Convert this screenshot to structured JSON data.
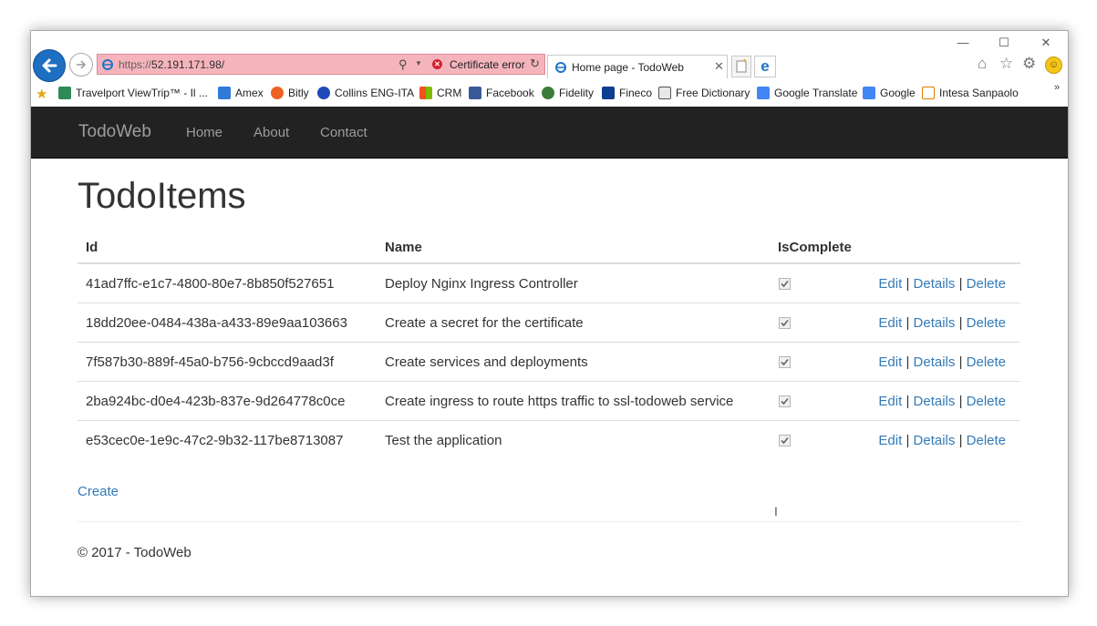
{
  "browser": {
    "window_controls": {
      "minimize": "—",
      "maximize": "☐",
      "close": "✕"
    },
    "address": {
      "scheme": "https://",
      "host": "52.191.171.98/"
    },
    "cert_error": "Certificate error",
    "tab_title": "Home page - TodoWeb",
    "tab_close": "✕",
    "favorites": [
      {
        "label": "Travelport ViewTrip™ - Il ...",
        "icon": "travelport-icon",
        "color": "#2e8b57"
      },
      {
        "label": "Amex",
        "icon": "amex-icon",
        "color": "#2f7bd6"
      },
      {
        "label": "Bitly",
        "icon": "bitly-icon",
        "color": "#ee6123"
      },
      {
        "label": "Collins ENG-ITA",
        "icon": "collins-icon",
        "color": "#1f49b5"
      },
      {
        "label": "CRM",
        "icon": "crm-icon",
        "color": "#f25022"
      },
      {
        "label": "Facebook",
        "icon": "facebook-icon",
        "color": "#3b5998"
      },
      {
        "label": "Fidelity",
        "icon": "fidelity-icon",
        "color": "#3a7d3a"
      },
      {
        "label": "Fineco",
        "icon": "fineco-icon",
        "color": "#0b3d91"
      },
      {
        "label": "Free Dictionary",
        "icon": "dictionary-icon",
        "color": "#555555"
      },
      {
        "label": "Google Translate",
        "icon": "translate-icon",
        "color": "#4285f4"
      },
      {
        "label": "Google",
        "icon": "google-icon",
        "color": "#4285f4"
      },
      {
        "label": "Intesa Sanpaolo",
        "icon": "intesa-icon",
        "color": "#e07b00"
      }
    ],
    "favorites_more": "»"
  },
  "nav": {
    "brand": "TodoWeb",
    "links": [
      "Home",
      "About",
      "Contact"
    ]
  },
  "page": {
    "title": "TodoItems",
    "columns": {
      "id": "Id",
      "name": "Name",
      "complete": "IsComplete"
    },
    "rows": [
      {
        "id": "41ad7ffc-e1c7-4800-80e7-8b850f527651",
        "name": "Deploy Nginx Ingress Controller",
        "complete": true
      },
      {
        "id": "18dd20ee-0484-438a-a433-89e9aa103663",
        "name": "Create a secret for the certificate",
        "complete": true
      },
      {
        "id": "7f587b30-889f-45a0-b756-9cbccd9aad3f",
        "name": "Create services and deployments",
        "complete": true
      },
      {
        "id": "2ba924bc-d0e4-423b-837e-9d264778c0ce",
        "name": "Create ingress to route https traffic to ssl-todoweb service",
        "complete": true
      },
      {
        "id": "e53cec0e-1e9c-47c2-9b32-117be8713087",
        "name": "Test the application",
        "complete": true
      }
    ],
    "actions": {
      "edit": "Edit",
      "details": "Details",
      "delete": "Delete",
      "separator": "|"
    },
    "create_label": "Create",
    "footer": "© 2017 - TodoWeb"
  },
  "colors": {
    "navbar_bg": "#222222",
    "nav_text": "#9d9d9d",
    "link": "#337ab7",
    "address_error_bg": "#f5b4bc"
  }
}
